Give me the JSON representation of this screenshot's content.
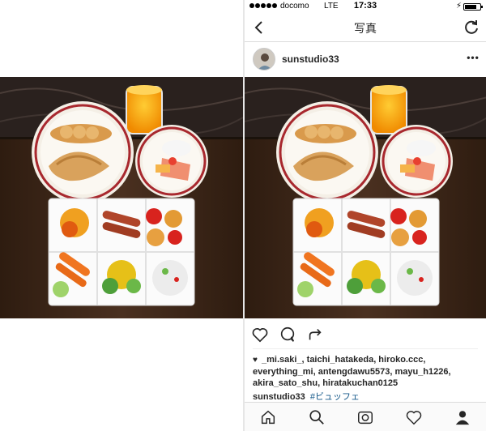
{
  "status_bar": {
    "carrier": "docomo",
    "network": "LTE",
    "time": "17:33",
    "signal_dots": 5
  },
  "nav": {
    "title": "写真",
    "back_icon": "chevron-left-icon",
    "refresh_icon": "refresh-icon"
  },
  "post": {
    "username": "sunstudio33",
    "more_icon": "ellipsis-icon",
    "likes_heart": "♥",
    "likes_text": "_mi.saki_, taichi_hatakeda, hiroko.ccc, everything_mi, antengdawu5573, mayu_h1226, akira_sato_shu, hiratakuchan0125",
    "caption_user": "sunstudio33",
    "caption_tag": "#ビュッフェ"
  },
  "actions": [
    "heart-icon",
    "comment-icon",
    "share-icon"
  ],
  "tabs": [
    "home-icon",
    "search-icon",
    "camera-icon",
    "activity-heart-icon",
    "profile-icon"
  ],
  "colors": {
    "link": "#125688",
    "text": "#262626",
    "table_wood": "#3a2618",
    "marble": "#2b2220"
  }
}
